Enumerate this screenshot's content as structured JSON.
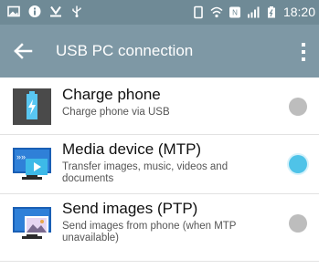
{
  "status_bar": {
    "time": "18:20",
    "icons": [
      "gallery-icon",
      "info-icon",
      "download-icon",
      "usb-icon",
      "vibrate-icon",
      "wifi-icon",
      "nfc-icon",
      "signal-icon",
      "battery-icon"
    ]
  },
  "app_bar": {
    "title": "USB PC connection",
    "back_icon": "back-arrow-icon",
    "menu_icon": "overflow-menu-icon"
  },
  "options": [
    {
      "title": "Charge phone",
      "subtitle": "Charge phone via USB",
      "icon": "battery-charge-icon",
      "selected": false
    },
    {
      "title": "Media device (MTP)",
      "subtitle": "Transfer images, music, videos and documents",
      "icon": "media-device-icon",
      "selected": true
    },
    {
      "title": "Send images (PTP)",
      "subtitle": "Send images from phone (when MTP unavailable)",
      "icon": "send-images-icon",
      "selected": false
    }
  ],
  "colors": {
    "status_bar": "#6f8a96",
    "app_bar": "#7e98a5",
    "radio_selected": "#4fc3e8",
    "radio_unselected": "#bdbdbd"
  }
}
